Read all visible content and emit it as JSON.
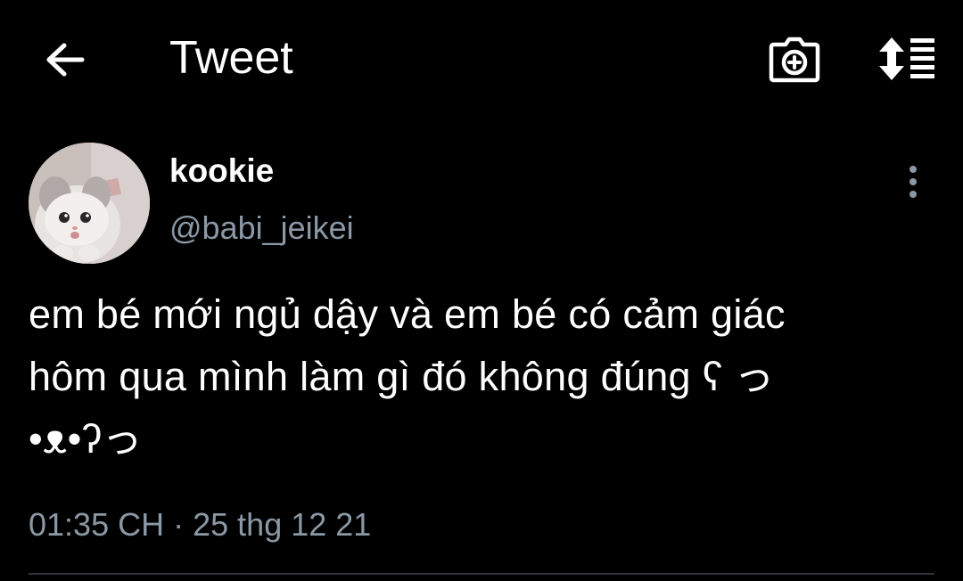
{
  "header": {
    "title": "Tweet",
    "back_icon": "arrow-left-icon",
    "camera_icon": "camera-plus-icon",
    "sort_icon": "sort-toggle-icon"
  },
  "tweet": {
    "display_name": "kookie",
    "handle": "@babi_jeikei",
    "text_line1": "em bé mới ngủ dậy và em bé có cảm giác",
    "text_line2": "hôm qua mình làm gì đó không đúng ʕ っ",
    "text_line3": "•ᴥ•ʔっ",
    "time": "01:35 CH",
    "separator": "·",
    "date": "25 thg 12 21",
    "more_icon": "more-vertical-icon"
  },
  "colors": {
    "background": "#000000",
    "primary_text": "#ffffff",
    "secondary_text": "#8b98a5",
    "divider": "#2f3336"
  }
}
